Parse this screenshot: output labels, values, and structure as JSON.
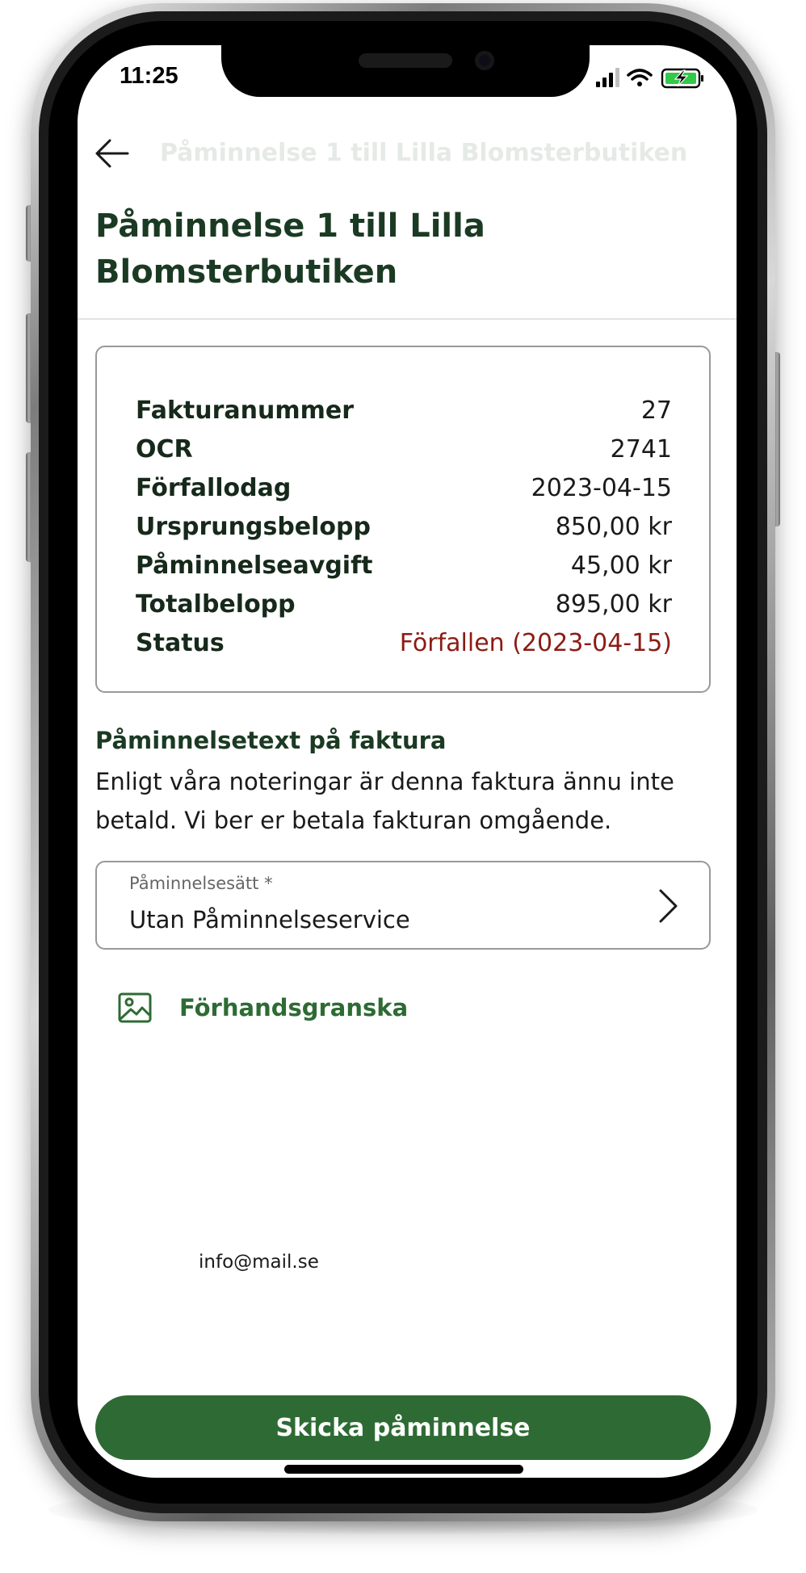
{
  "status_bar": {
    "time": "11:25"
  },
  "header": {
    "collapsed_title": "Påminnelse 1 till Lilla Blomsterbutiken",
    "title": "Påminnelse 1 till Lilla Blomsterbutiken",
    "back_icon": "arrow-left-icon"
  },
  "invoice": {
    "rows": [
      {
        "label": "Fakturanummer",
        "value": "27"
      },
      {
        "label": "OCR",
        "value": "2741"
      },
      {
        "label": "Förfallodag",
        "value": "2023-04-15"
      },
      {
        "label": "Ursprungsbelopp",
        "value": "850,00 kr"
      },
      {
        "label": "Påminnelseavgift",
        "value": "45,00 kr"
      },
      {
        "label": "Totalbelopp",
        "value": "895,00 kr"
      },
      {
        "label": "Status",
        "value": "Förfallen (2023-04-15)"
      }
    ]
  },
  "reminder_text": {
    "heading": "Påminnelsetext på faktura",
    "body": "Enligt våra noteringar är denna faktura ännu inte betald. Vi ber er betala fakturan omgående."
  },
  "reminder_method": {
    "label": "Påminnelsesätt *",
    "value": "Utan Påminnelseservice"
  },
  "preview": {
    "label": "Förhandsgranska",
    "icon": "image-icon"
  },
  "contact": {
    "email": "info@mail.se"
  },
  "actions": {
    "send_label": "Skicka påminnelse"
  },
  "colors": {
    "primary_green": "#2e6b34",
    "title_green": "#1b3a23",
    "status_overdue": "#8b1c14"
  }
}
